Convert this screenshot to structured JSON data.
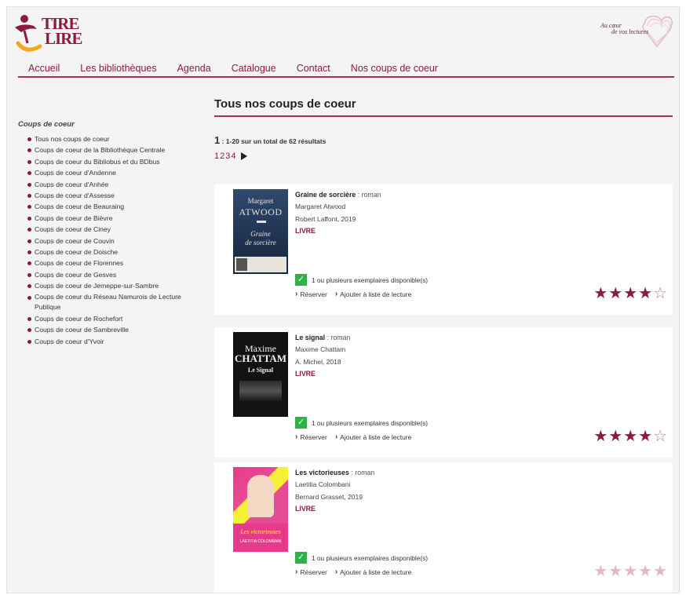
{
  "header": {
    "logo_line1": "TIRE",
    "logo_line2": "LIRE",
    "partner_line1": "Au cœur",
    "partner_line2": "de vos lectures"
  },
  "nav": {
    "items": [
      "Accueil",
      "Les bibliothèques",
      "Agenda",
      "Catalogue",
      "Contact",
      "Nos coups de coeur"
    ]
  },
  "sidebar": {
    "title": "Coups de coeur",
    "items": [
      "Tous nos coups de coeur",
      "Coups de coeur de la Bibliothèque Centrale",
      "Coups de coeur du Bibliobus et du BDbus",
      "Coups de coeur d'Andenne",
      "Coups de coeur d'Anhée",
      "Coups de coeur d'Assesse",
      "Coups de coeur de Beauraing",
      "Coups de coeur de Bièvre",
      "Coups de coeur de Ciney",
      "Coups de coeur de Couvin",
      "Coups de coeur de Doische",
      "Coups de coeur de Florennes",
      "Coups de coeur de Gesves",
      "Coups de coeur de Jemeppe-sur-Sambre",
      "Coups de coeur du Réseau Namurois de Lecture Publique",
      "Coups de coeur de Rochefort",
      "Coups de coeur de Sambreville",
      "Coups de coeur d'Yvoir"
    ]
  },
  "main": {
    "title": "Tous nos coups de coeur",
    "results_page": "1",
    "results_text": ": 1-20 sur un total de 62 résultats",
    "pages": [
      "1",
      "2",
      "3",
      "4"
    ]
  },
  "books": [
    {
      "title": "Graine de sorcière",
      "genre": ": roman",
      "author": "Margaret Atwood",
      "publisher": "Robert Laffont, 2019",
      "type": "LIVRE",
      "availability": "1 ou plusieurs exemplaires disponible(s)",
      "reserve": "Réserver",
      "add_list": "Ajouter à liste de lecture",
      "rating": 4,
      "cover_line1": "Margaret",
      "cover_line2": "ATWOOD",
      "cover_line3": "Graine",
      "cover_line4": "de sorcière"
    },
    {
      "title": "Le signal",
      "genre": ": roman",
      "author": "Maxime Chattam",
      "publisher": "A. Michel, 2018",
      "type": "LIVRE",
      "availability": "1 ou plusieurs exemplaires disponible(s)",
      "reserve": "Réserver",
      "add_list": "Ajouter à liste de lecture",
      "rating": 4,
      "cover_line1": "Maxime",
      "cover_line2": "CHATTAM",
      "cover_line3": "Le Signal"
    },
    {
      "title": "Les victorieuses",
      "genre": ": roman",
      "author": "Laetitia Colombani",
      "publisher": "Bernard Grasset, 2019",
      "type": "LIVRE",
      "availability": "1 ou plusieurs exemplaires disponible(s)",
      "reserve": "Réserver",
      "add_list": "Ajouter à liste de lecture",
      "rating": 0,
      "cover_line1": "Les victorieuses",
      "cover_line2": "LAETITIA COLOMBANI"
    }
  ],
  "colors": {
    "brand": "#8a1a3e",
    "rule": "#a3334f",
    "available": "#2eb34a"
  }
}
